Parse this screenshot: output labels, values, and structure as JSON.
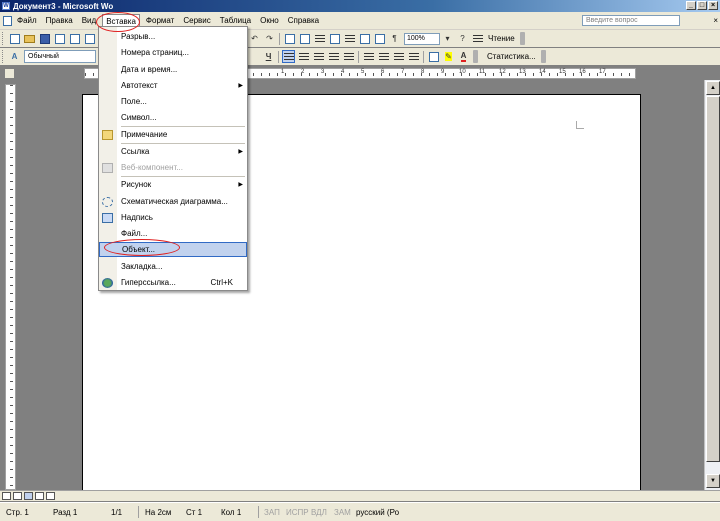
{
  "window": {
    "title": "Документ3 - Microsoft Wo",
    "buttons": [
      "_",
      "□",
      "×"
    ]
  },
  "menubar": {
    "items": [
      "Файл",
      "Правка",
      "Вид",
      "Вставка",
      "Формат",
      "Сервис",
      "Таблица",
      "Окно",
      "Справка"
    ],
    "active_index": 3,
    "ask_placeholder": "Введите вопрос",
    "doc_close": "×"
  },
  "toolbar1": {
    "zoom": "100%",
    "reading_label": "Чтение"
  },
  "toolbar2": {
    "style": "Обычный",
    "underline_glyph": "Ч",
    "stats_label": "Статистика..."
  },
  "ruler": {
    "numbers": [
      "1",
      "2",
      "3",
      "4",
      "5",
      "6",
      "7",
      "8",
      "9",
      "10",
      "11",
      "12",
      "13",
      "14",
      "15",
      "16",
      "17"
    ]
  },
  "insert_menu": {
    "items": [
      {
        "label": "Разрыв...",
        "icon": "",
        "submenu": false,
        "disabled": false,
        "shortcut": ""
      },
      {
        "label": "Номера страниц...",
        "icon": "",
        "submenu": false,
        "disabled": false,
        "shortcut": ""
      },
      {
        "label": "Дата и время...",
        "icon": "",
        "submenu": false,
        "disabled": false,
        "shortcut": ""
      },
      {
        "label": "Автотекст",
        "icon": "",
        "submenu": true,
        "disabled": false,
        "shortcut": ""
      },
      {
        "label": "Поле...",
        "icon": "",
        "submenu": false,
        "disabled": false,
        "shortcut": ""
      },
      {
        "label": "Символ...",
        "icon": "",
        "submenu": false,
        "disabled": false,
        "shortcut": ""
      },
      {
        "label": "Примечание",
        "icon": "comment-icon",
        "submenu": false,
        "disabled": false,
        "shortcut": ""
      },
      {
        "label": "Ссылка",
        "icon": "",
        "submenu": true,
        "disabled": false,
        "shortcut": ""
      },
      {
        "label": "Веб-компонент...",
        "icon": "web-component-icon",
        "submenu": false,
        "disabled": true,
        "shortcut": ""
      },
      {
        "label": "Рисунок",
        "icon": "",
        "submenu": true,
        "disabled": false,
        "shortcut": ""
      },
      {
        "label": "Схематическая диаграмма...",
        "icon": "diagram-icon",
        "submenu": false,
        "disabled": false,
        "shortcut": ""
      },
      {
        "label": "Надпись",
        "icon": "text-box-icon",
        "submenu": false,
        "disabled": false,
        "shortcut": ""
      },
      {
        "label": "Файл...",
        "icon": "",
        "submenu": false,
        "disabled": false,
        "shortcut": ""
      },
      {
        "label": "Объект...",
        "icon": "",
        "submenu": false,
        "disabled": false,
        "shortcut": "",
        "highlighted": true
      },
      {
        "label": "Закладка...",
        "icon": "",
        "submenu": false,
        "disabled": false,
        "shortcut": ""
      },
      {
        "label": "Гиперссылка...",
        "icon": "hyperlink-icon",
        "submenu": false,
        "disabled": false,
        "shortcut": "Ctrl+K"
      }
    ]
  },
  "statusbar": {
    "page": "Стр. 1",
    "section": "Разд 1",
    "pages": "1/1",
    "at": "На 2см",
    "line": "Ст 1",
    "col": "Кол 1",
    "rec": "ЗАП",
    "trk": "ИСПР",
    "ext": "ВДЛ",
    "ovr": "ЗАМ",
    "lang": "русский (Ро"
  },
  "colors": {
    "highlight": "#c1d2ee",
    "highlight_border": "#316ac5",
    "annotation": "#e02020",
    "chrome": "#ece9d8"
  }
}
